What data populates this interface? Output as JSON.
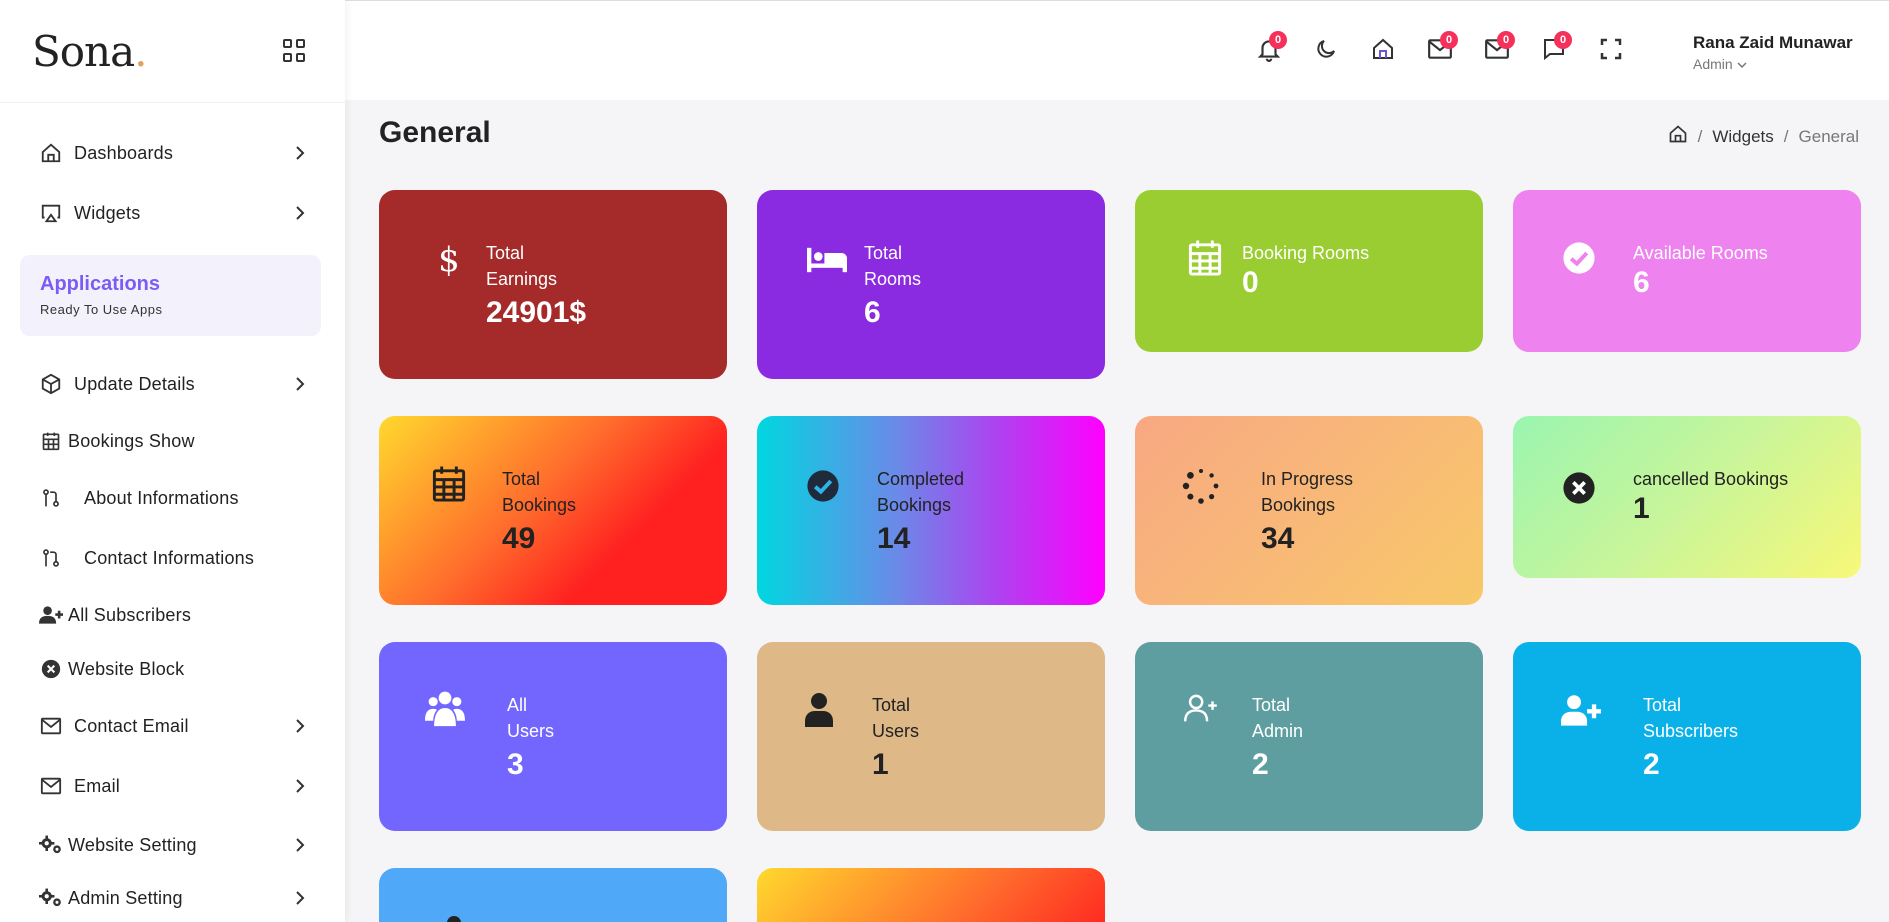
{
  "sidebar": {
    "logo": "Sona",
    "logo_dot": ".",
    "items_top": [
      {
        "label": "Dashboards"
      },
      {
        "label": "Widgets"
      }
    ],
    "apps_box": {
      "title": "Applications",
      "subtitle": "Ready To Use Apps"
    },
    "items": [
      {
        "label": "Update Details"
      },
      {
        "label": "Bookings Show"
      },
      {
        "label": "About Informations"
      },
      {
        "label": "Contact Informations"
      },
      {
        "label": "All Subscribers"
      },
      {
        "label": "Website Block"
      },
      {
        "label": "Contact Email"
      },
      {
        "label": "Email"
      },
      {
        "label": "Website Setting"
      },
      {
        "label": "Admin Setting"
      }
    ]
  },
  "header": {
    "badges": {
      "notifications": "0",
      "mail1": "0",
      "mail2": "0",
      "messages": "0"
    },
    "user": {
      "name": "Rana Zaid Munawar",
      "role": "Admin"
    }
  },
  "page": {
    "title": "General",
    "breadcrumb": {
      "middle": "Widgets",
      "current": "General"
    }
  },
  "cards": [
    {
      "label": "Total\nEarnings",
      "value": "24901$",
      "color": "#a52a2a",
      "icon": "dollar-icon"
    },
    {
      "label": "Total\nRooms",
      "value": "6",
      "color": "#8a2be2",
      "icon": "bed-icon"
    },
    {
      "label": "Booking Rooms",
      "value": "0",
      "color": "#9acd32",
      "icon": "calendar-icon"
    },
    {
      "label": "Available Rooms",
      "value": "6",
      "color": "#ee82ee",
      "icon": "check-circle-icon"
    },
    {
      "label": "Total\nBookings",
      "value": "49",
      "color": "#ff3b2f",
      "icon": "calendar-icon"
    },
    {
      "label": "Completed\nBookings",
      "value": "14",
      "color": "#7b68ee",
      "icon": "check-circle-icon"
    },
    {
      "label": "In Progress\nBookings",
      "value": "34",
      "color": "#f8b878",
      "icon": "spinner-icon"
    },
    {
      "label": "cancelled Bookings",
      "value": "1",
      "color": "#c0f08a",
      "icon": "x-circle-icon"
    },
    {
      "label": "All\nUsers",
      "value": "3",
      "color": "#7366ff",
      "icon": "users-icon"
    },
    {
      "label": "Total\nUsers",
      "value": "1",
      "color": "#deb887",
      "icon": "user-icon"
    },
    {
      "label": "Total\nAdmin",
      "value": "2",
      "color": "#5f9ea0",
      "icon": "user-plus-icon"
    },
    {
      "label": "Total\nSubscribers",
      "value": "2",
      "color": "#0ab0e8",
      "icon": "user-plus-icon"
    }
  ]
}
